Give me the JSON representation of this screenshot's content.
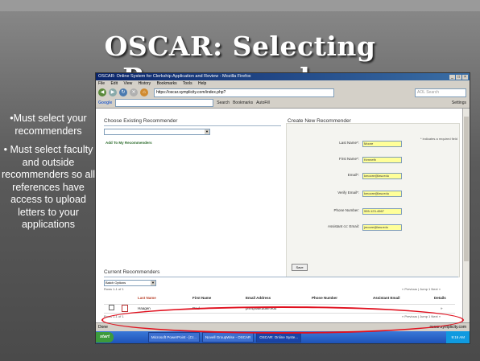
{
  "slide": {
    "title": "OSCAR: Selecting Recommenders",
    "bullets": [
      "•Must select your recommenders",
      "• Must select faculty and outside recommenders so all references have access to upload letters to your applications"
    ]
  },
  "browser": {
    "window_title": "OSCAR: Online System for Clerkship Application and Review - Mozilla Firefox",
    "window_buttons": [
      "_",
      "□",
      "×"
    ],
    "menu": [
      "File",
      "Edit",
      "View",
      "History",
      "Bookmarks",
      "Tools",
      "Help"
    ],
    "url": "https://oscar.symplicity.com/index.php?",
    "search_placeholder": "AOL Search",
    "google_label": "Google",
    "google_search": "Search",
    "bookmarks_label": "Bookmarks",
    "autofill_label": "AutoFill",
    "settings_label": "Settings"
  },
  "page": {
    "choose_existing_title": "Choose Existing Recommender",
    "add_to_my_recommenders": "Add To My Recommenders",
    "create_new_title": "Create New Recommender",
    "required_note": "* indicates a required field",
    "fields": [
      {
        "label": "Last Name*:",
        "value": "Moore"
      },
      {
        "label": "First Name*:",
        "value": "Kenneth"
      },
      {
        "label": "Email*:",
        "value": "kmoore@law.edu"
      },
      {
        "label": "Verify Email*:",
        "value": "kmoore@law.edu"
      },
      {
        "label": "Phone Number:",
        "value": "555-123-4567"
      },
      {
        "label": "Assistant cc: Email:",
        "value": "jmoore@law.edu"
      }
    ],
    "save_button": "Save",
    "current_title": "Current Recommenders",
    "batch_options": "Batch Options",
    "rows_count_top": "Rows 1-1 of 1",
    "rows_count_bottom": "Rows 1-1 of 1",
    "pager": "« Previous | Jump 1 Next »",
    "table": {
      "headers": [
        "Last Name",
        "First Name",
        "Email Address",
        "Phone Number",
        "Assistant Email",
        "Details"
      ],
      "rows": [
        {
          "last": "Haagen",
          "first": "Paul",
          "email": "phh@law.duke.edu",
          "phone": "",
          "assistant": "",
          "details": "»"
        }
      ]
    }
  },
  "statusbar": {
    "left": "Done",
    "right": "oscar.symplicity.com"
  },
  "taskbar": {
    "start": "start",
    "tasks": [
      "Microsoft PowerPoint - [Cr...",
      "Novell GroupWise - OSCAR",
      "OSCAR: Online Syste..."
    ],
    "clock": "9:16 AM"
  }
}
